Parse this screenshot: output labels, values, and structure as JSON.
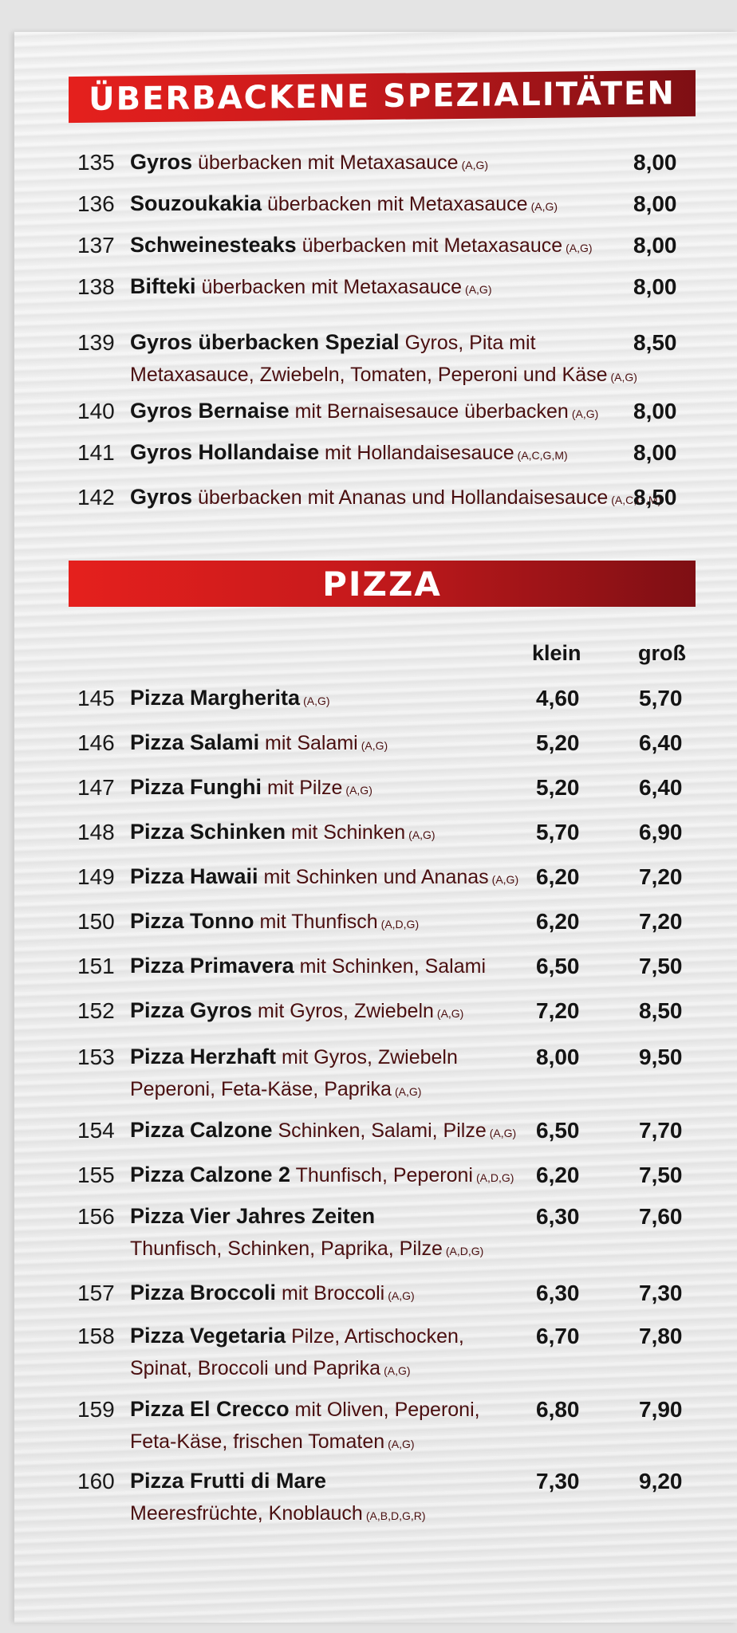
{
  "sections": {
    "specials": {
      "title": "ÜBERBACKENE SPEZIALITÄTEN",
      "items": [
        {
          "nr": "135",
          "name": "Gyros",
          "desc": "überbacken mit Metaxasauce",
          "allergens": "(A,G)",
          "price": "8,00"
        },
        {
          "nr": "136",
          "name": "Souzoukakia",
          "desc": "überbacken mit Metaxasauce",
          "allergens": "(A,G)",
          "price": "8,00"
        },
        {
          "nr": "137",
          "name": "Schweinesteaks",
          "desc": "überbacken mit Metaxasauce",
          "allergens": "(A,G)",
          "price": "8,00"
        },
        {
          "nr": "138",
          "name": "Bifteki",
          "desc": "überbacken mit Metaxasauce",
          "allergens": "(A,G)",
          "price": "8,00"
        },
        {
          "nr": "139",
          "name": "Gyros überbacken Spezial",
          "desc": "Gyros, Pita mit",
          "desc2": "Metaxasauce, Zwiebeln, Tomaten, Peperoni und Käse",
          "allergens": "(A,G)",
          "price": "8,50"
        },
        {
          "nr": "140",
          "name": "Gyros Bernaise",
          "desc": "mit Bernaisesauce überbacken",
          "allergens": "(A,G)",
          "price": "8,00"
        },
        {
          "nr": "141",
          "name": "Gyros Hollandaise",
          "desc": "mit Hollandaisesauce",
          "allergens": "(A,C,G,M)",
          "price": "8,00"
        },
        {
          "nr": "142",
          "name": "Gyros",
          "desc": "überbacken mit Ananas und Hollandaisesauce",
          "allergens": "(A,C,G,M)",
          "price": "8,50"
        }
      ]
    },
    "pizza": {
      "title": "PIZZA",
      "col_small": "klein",
      "col_large": "groß",
      "items": [
        {
          "nr": "145",
          "name": "Pizza Margherita",
          "desc": "",
          "allergens": "(A,G)",
          "small": "4,60",
          "large": "5,70"
        },
        {
          "nr": "146",
          "name": "Pizza Salami",
          "desc": "mit Salami",
          "allergens": "(A,G)",
          "small": "5,20",
          "large": "6,40"
        },
        {
          "nr": "147",
          "name": "Pizza Funghi",
          "desc": "mit Pilze",
          "allergens": "(A,G)",
          "small": "5,20",
          "large": "6,40"
        },
        {
          "nr": "148",
          "name": "Pizza Schinken",
          "desc": "mit Schinken",
          "allergens": "(A,G)",
          "small": "5,70",
          "large": "6,90"
        },
        {
          "nr": "149",
          "name": "Pizza Hawaii",
          "desc": "mit Schinken und Ananas",
          "allergens": "(A,G)",
          "small": "6,20",
          "large": "7,20"
        },
        {
          "nr": "150",
          "name": "Pizza Tonno",
          "desc": "mit Thunfisch",
          "allergens": "(A,D,G)",
          "small": "6,20",
          "large": "7,20"
        },
        {
          "nr": "151",
          "name": "Pizza Primavera",
          "desc": "mit Schinken, Salami",
          "allergens": "",
          "small": "6,50",
          "large": "7,50"
        },
        {
          "nr": "152",
          "name": "Pizza Gyros",
          "desc": "mit Gyros, Zwiebeln",
          "allergens": "(A,G)",
          "small": "7,20",
          "large": "8,50"
        },
        {
          "nr": "153",
          "name": "Pizza Herzhaft",
          "desc": "mit Gyros, Zwiebeln",
          "desc2": "Peperoni, Feta-Käse, Paprika",
          "allergens": "(A,G)",
          "small": "8,00",
          "large": "9,50"
        },
        {
          "nr": "154",
          "name": "Pizza Calzone",
          "desc": "Schinken, Salami, Pilze",
          "allergens": "(A,G)",
          "small": "6,50",
          "large": "7,70"
        },
        {
          "nr": "155",
          "name": "Pizza Calzone 2",
          "desc": "Thunfisch, Peperoni",
          "allergens": "(A,D,G)",
          "small": "6,20",
          "large": "7,50"
        },
        {
          "nr": "156",
          "name": "Pizza Vier Jahres Zeiten",
          "desc": "",
          "desc2": "Thunfisch, Schinken, Paprika, Pilze",
          "allergens": "(A,D,G)",
          "small": "6,30",
          "large": "7,60"
        },
        {
          "nr": "157",
          "name": "Pizza Broccoli",
          "desc": "mit Broccoli",
          "allergens": "(A,G)",
          "small": "6,30",
          "large": "7,30"
        },
        {
          "nr": "158",
          "name": "Pizza Vegetaria",
          "desc": "Pilze, Artischocken,",
          "desc2": "Spinat, Broccoli und Paprika",
          "allergens": "(A,G)",
          "small": "6,70",
          "large": "7,80"
        },
        {
          "nr": "159",
          "name": "Pizza El Crecco",
          "desc": "mit Oliven, Peperoni,",
          "desc2": "Feta-Käse, frischen Tomaten",
          "allergens": "(A,G)",
          "small": "6,80",
          "large": "7,90"
        },
        {
          "nr": "160",
          "name": "Pizza Frutti di Mare",
          "desc": "",
          "desc2": "Meeresfrüchte, Knoblauch",
          "allergens": "(A,B,D,G,R)",
          "small": "7,30",
          "large": "9,20"
        }
      ]
    }
  }
}
